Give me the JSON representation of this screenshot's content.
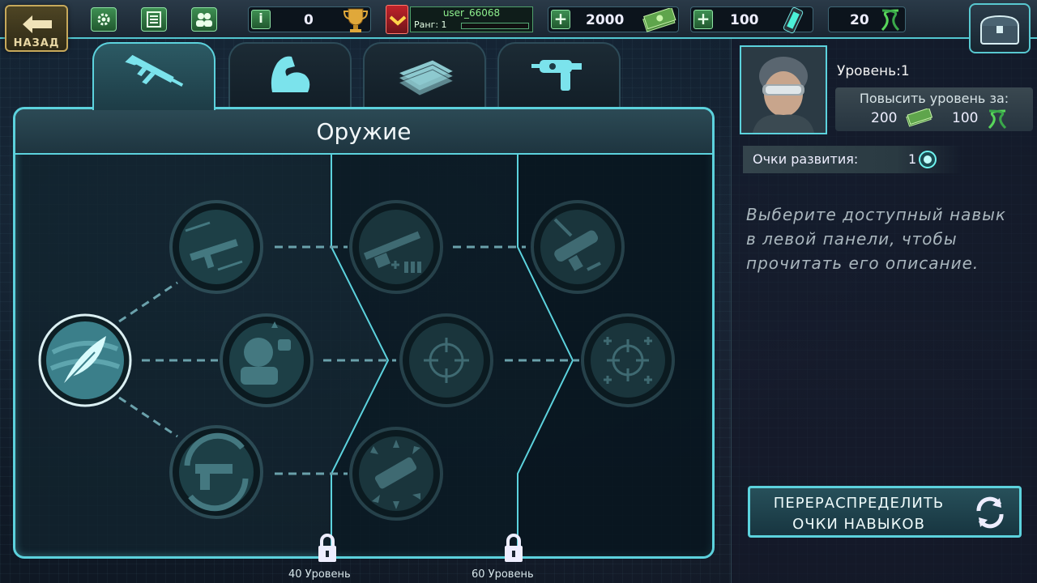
{
  "topbar": {
    "back_label": "НАЗАД",
    "trophy_count": "0",
    "username": "user_66068",
    "rank_label": "Ранг: 1",
    "cash": "2000",
    "crystals": "100",
    "dna": "20"
  },
  "tabs": [
    {
      "name": "weapons",
      "icon": "rifle-icon",
      "active": true
    },
    {
      "name": "strength",
      "icon": "bicep-icon",
      "active": false
    },
    {
      "name": "money",
      "icon": "cash-stack-icon",
      "active": false
    },
    {
      "name": "injector",
      "icon": "syringe-gun-icon",
      "active": false
    }
  ],
  "panel": {
    "title": "Оружие",
    "locks": [
      {
        "label": "40 Уровень"
      },
      {
        "label": "60 Уровень"
      }
    ],
    "skills": [
      {
        "id": "feather",
        "icon": "feather-icon",
        "state": "active"
      },
      {
        "id": "rifle-speed",
        "icon": "rifle-speed-icon",
        "state": "available"
      },
      {
        "id": "soldier-punch",
        "icon": "soldier-punch-icon",
        "state": "available"
      },
      {
        "id": "pistol-reload",
        "icon": "pistol-reload-icon",
        "state": "available"
      },
      {
        "id": "shotgun-ammo",
        "icon": "shotgun-ammo-icon",
        "state": "locked"
      },
      {
        "id": "crosshair",
        "icon": "crosshair-icon",
        "state": "locked"
      },
      {
        "id": "explosive",
        "icon": "explosive-icon",
        "state": "locked"
      },
      {
        "id": "grenade-launcher",
        "icon": "grenade-launcher-icon",
        "state": "locked"
      },
      {
        "id": "crosshair-plus",
        "icon": "crosshair-plus-icon",
        "state": "locked"
      }
    ]
  },
  "profile": {
    "level_label": "Уровень:1",
    "upgrade_label": "Повысить уровень за:",
    "upgrade_cash": "200",
    "upgrade_dna": "100",
    "points_label": "Очки развития:",
    "points_value": "1",
    "description": "Выберите доступный навык в левой панели, чтобы прочитать его описание.",
    "respec_label": "ПЕРЕРАСПРЕДЕЛИТЬ ОЧКИ НАВЫКОВ"
  },
  "colors": {
    "accent": "#5cd2dd",
    "back_button": "#c7a95b",
    "green_button": "#3e8f52",
    "rank_red": "#c0232a"
  }
}
